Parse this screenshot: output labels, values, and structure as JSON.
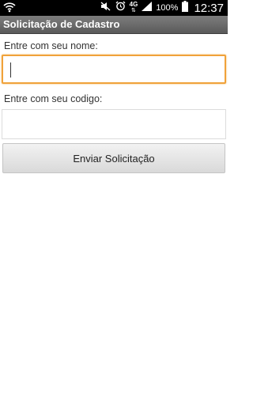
{
  "status_bar": {
    "network_type": "4G",
    "battery_percent": "100%",
    "time": "12:37",
    "icons": [
      "wifi-icon",
      "mute-icon",
      "alarm-icon",
      "signal-icon",
      "battery-icon"
    ]
  },
  "app": {
    "title": "Solicitação de Cadastro"
  },
  "form": {
    "name_label": "Entre com seu nome:",
    "name_value": "",
    "code_label": "Entre com seu codigo:",
    "code_value": "",
    "submit_label": "Enviar Solicitação"
  },
  "colors": {
    "focus_border": "#f0a23a",
    "title_bar": "#6b6b6b",
    "status_bar": "#000000"
  }
}
